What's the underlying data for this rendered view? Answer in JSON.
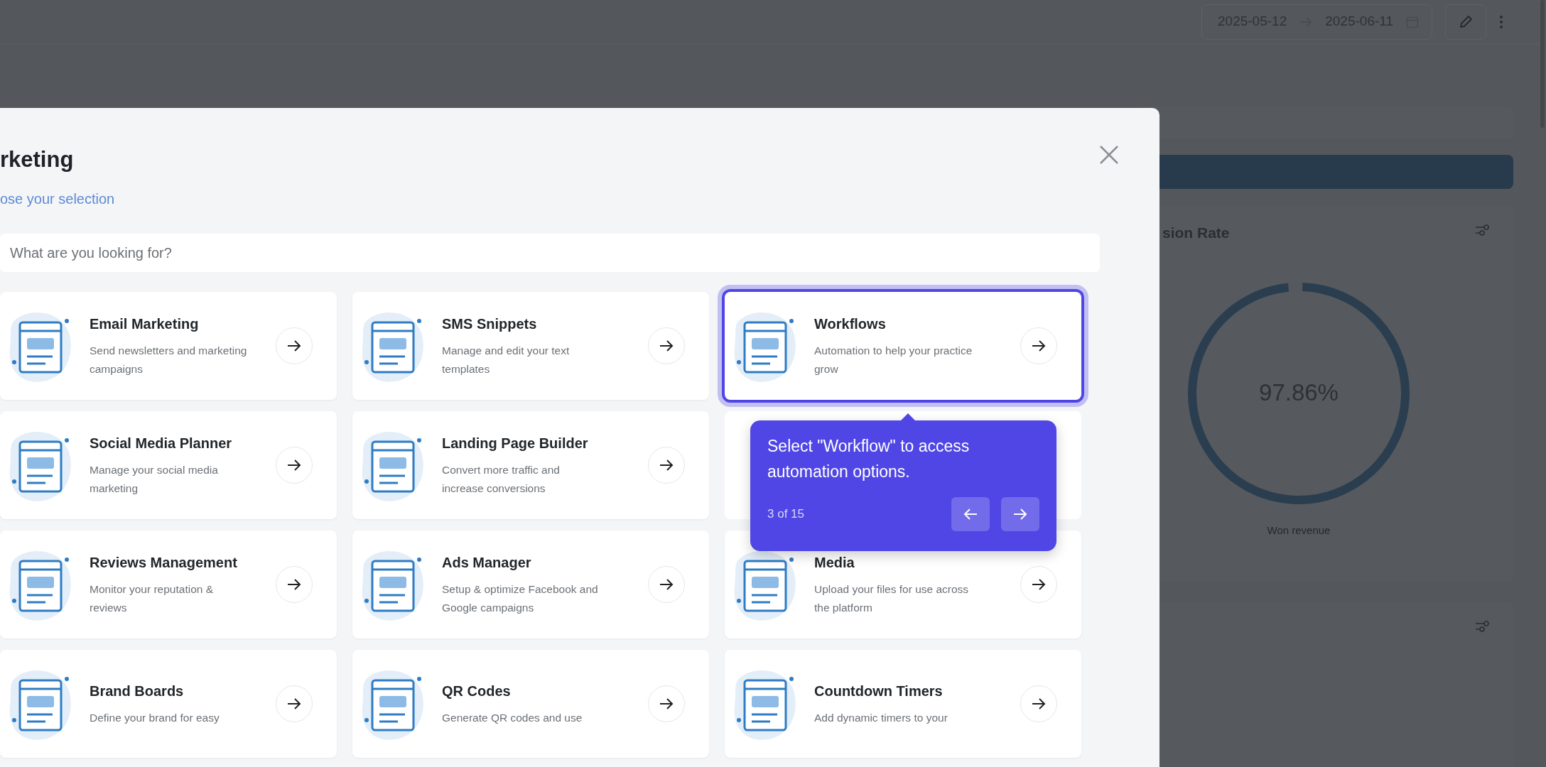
{
  "background": {
    "date_start": "2025-05-12",
    "date_end": "2025-06-11",
    "panel_title": "sion Rate",
    "donut": {
      "value": "97.86%",
      "label": "Won revenue",
      "level": 0.9786
    }
  },
  "modal": {
    "title": "rketing",
    "subtitle": "ose your selection",
    "search": {
      "placeholder": "What are you looking for?"
    },
    "cards": [
      {
        "kind": "option",
        "title": "Email Marketing",
        "description": "Send newsletters and marketing campaigns",
        "selected": false
      },
      {
        "kind": "option",
        "title": "SMS Snippets",
        "description": "Manage and edit your text templates",
        "selected": false
      },
      {
        "kind": "option",
        "title": "Workflows",
        "description": "Automation to help your practice grow",
        "selected": true
      },
      {
        "kind": "option",
        "title": "Social Media Planner",
        "description": "Manage your social media marketing",
        "selected": false
      },
      {
        "kind": "option",
        "title": "Landing Page Builder",
        "description": "Convert more traffic and increase conversions",
        "selected": false
      },
      {
        "kind": "covered"
      },
      {
        "kind": "option",
        "title": "Reviews Management",
        "description": "Monitor your reputation & reviews",
        "selected": false
      },
      {
        "kind": "option",
        "title": "Ads Manager",
        "description": "Setup & optimize Facebook and Google campaigns",
        "selected": false
      },
      {
        "kind": "option",
        "title": "Media",
        "description": "Upload your files for use across the platform",
        "selected": false
      },
      {
        "kind": "option",
        "title": "Brand Boards",
        "description": "Define your brand for easy",
        "selected": false
      },
      {
        "kind": "option",
        "title": "QR Codes",
        "description": "Generate QR codes and use",
        "selected": false
      },
      {
        "kind": "option",
        "title": "Countdown Timers",
        "description": "Add dynamic timers to your",
        "selected": false
      }
    ]
  },
  "tour_tooltip": {
    "text": "Select \"Workflow\" to access automation options.",
    "step": "3 of 15"
  }
}
